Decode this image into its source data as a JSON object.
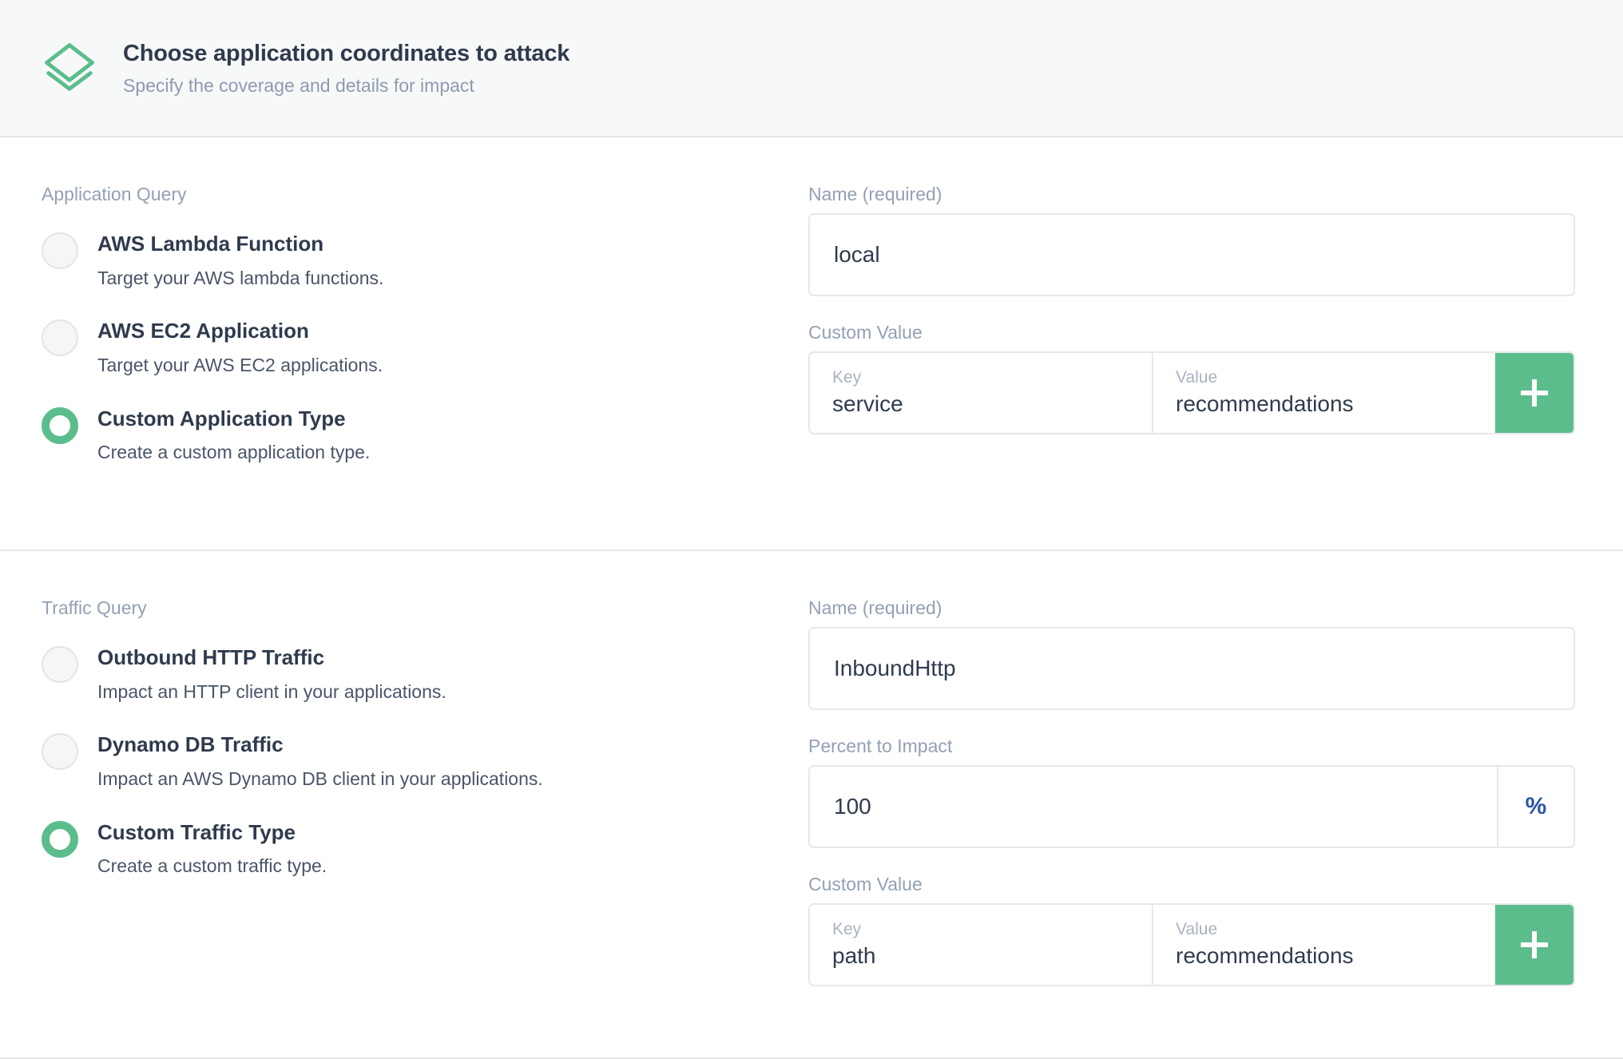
{
  "header": {
    "icon": "layers-icon",
    "title": "Choose application coordinates to attack",
    "subtitle": "Specify the coverage and details for impact"
  },
  "colors": {
    "accent_green": "#5cbd8c",
    "header_bg": "#f7f8f8",
    "title_text": "#2f3b4d",
    "muted_text": "#93a0b4",
    "percent_blue": "#2a54a8"
  },
  "application_section": {
    "group_label": "Application Query",
    "options": [
      {
        "title": "AWS Lambda Function",
        "description": "Target your AWS lambda functions.",
        "selected": false
      },
      {
        "title": "AWS EC2 Application",
        "description": "Target your AWS EC2 applications.",
        "selected": false
      },
      {
        "title": "Custom Application Type",
        "description": "Create a custom application type.",
        "selected": true
      }
    ],
    "name_field": {
      "label": "Name (required)",
      "value": "local",
      "placeholder": ""
    },
    "custom_value": {
      "label": "Custom Value",
      "key_label": "Key",
      "key_value": "service",
      "value_label": "Value",
      "value_value": "recommendations",
      "add_icon": "plus-icon"
    }
  },
  "traffic_section": {
    "group_label": "Traffic Query",
    "options": [
      {
        "title": "Outbound HTTP Traffic",
        "description": "Impact an HTTP client in your applications.",
        "selected": false
      },
      {
        "title": "Dynamo DB Traffic",
        "description": "Impact an AWS Dynamo DB client in your applications.",
        "selected": false
      },
      {
        "title": "Custom Traffic Type",
        "description": "Create a custom traffic type.",
        "selected": true
      }
    ],
    "name_field": {
      "label": "Name (required)",
      "value": "InboundHttp",
      "placeholder": ""
    },
    "percent_field": {
      "label": "Percent to Impact",
      "value": "100",
      "suffix": "%"
    },
    "custom_value": {
      "label": "Custom Value",
      "key_label": "Key",
      "key_value": "path",
      "value_label": "Value",
      "value_value": "recommendations",
      "add_icon": "plus-icon"
    }
  }
}
